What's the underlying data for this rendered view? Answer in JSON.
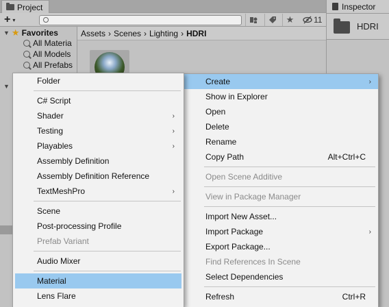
{
  "project_window": {
    "tab_label": "Project",
    "create_button": {
      "icon": "plus-icon",
      "caret": "▾"
    },
    "search": {
      "value": "",
      "placeholder": ""
    },
    "toolbar_icons": [
      "scene-filter-icon",
      "label-tag-icon",
      "favorite-star-icon"
    ],
    "hidden_count": "11",
    "favorites": {
      "header": "Favorites",
      "items": [
        "All Materia",
        "All Models",
        "All Prefabs"
      ]
    },
    "breadcrumb": [
      "Assets",
      "Scenes",
      "Lighting",
      "HDRI"
    ],
    "asset_thumbnail": "hdri-sphere-thumbnail"
  },
  "inspector": {
    "tab_label": "Inspector",
    "title": "HDRI"
  },
  "context_menu": {
    "items": [
      {
        "label": "Create",
        "submenu": true,
        "selected": true
      },
      {
        "label": "Show in Explorer"
      },
      {
        "label": "Open"
      },
      {
        "label": "Delete"
      },
      {
        "label": "Rename"
      },
      {
        "label": "Copy Path",
        "shortcut": "Alt+Ctrl+C"
      },
      {
        "label": "Open Scene Additive",
        "disabled": true
      },
      {
        "label": "View in Package Manager",
        "disabled": true
      },
      {
        "label": "Import New Asset..."
      },
      {
        "label": "Import Package",
        "submenu": true
      },
      {
        "label": "Export Package..."
      },
      {
        "label": "Find References In Scene",
        "disabled": true
      },
      {
        "label": "Select Dependencies"
      },
      {
        "label": "Refresh",
        "shortcut": "Ctrl+R"
      }
    ]
  },
  "create_submenu": {
    "items": [
      {
        "label": "Folder"
      },
      {
        "label": "C# Script"
      },
      {
        "label": "Shader",
        "submenu": true
      },
      {
        "label": "Testing",
        "submenu": true
      },
      {
        "label": "Playables",
        "submenu": true
      },
      {
        "label": "Assembly Definition"
      },
      {
        "label": "Assembly Definition Reference"
      },
      {
        "label": "TextMeshPro",
        "submenu": true
      },
      {
        "label": "Scene"
      },
      {
        "label": "Post-processing Profile"
      },
      {
        "label": "Prefab Variant",
        "disabled": true
      },
      {
        "label": "Audio Mixer"
      },
      {
        "label": "Material",
        "selected": true
      },
      {
        "label": "Lens Flare"
      }
    ]
  },
  "colors": {
    "highlight": "#99c9ef",
    "menu_bg": "#f2f2f2",
    "disabled_text": "#8a8a8a",
    "panel_bg": "#c2c2c2"
  }
}
